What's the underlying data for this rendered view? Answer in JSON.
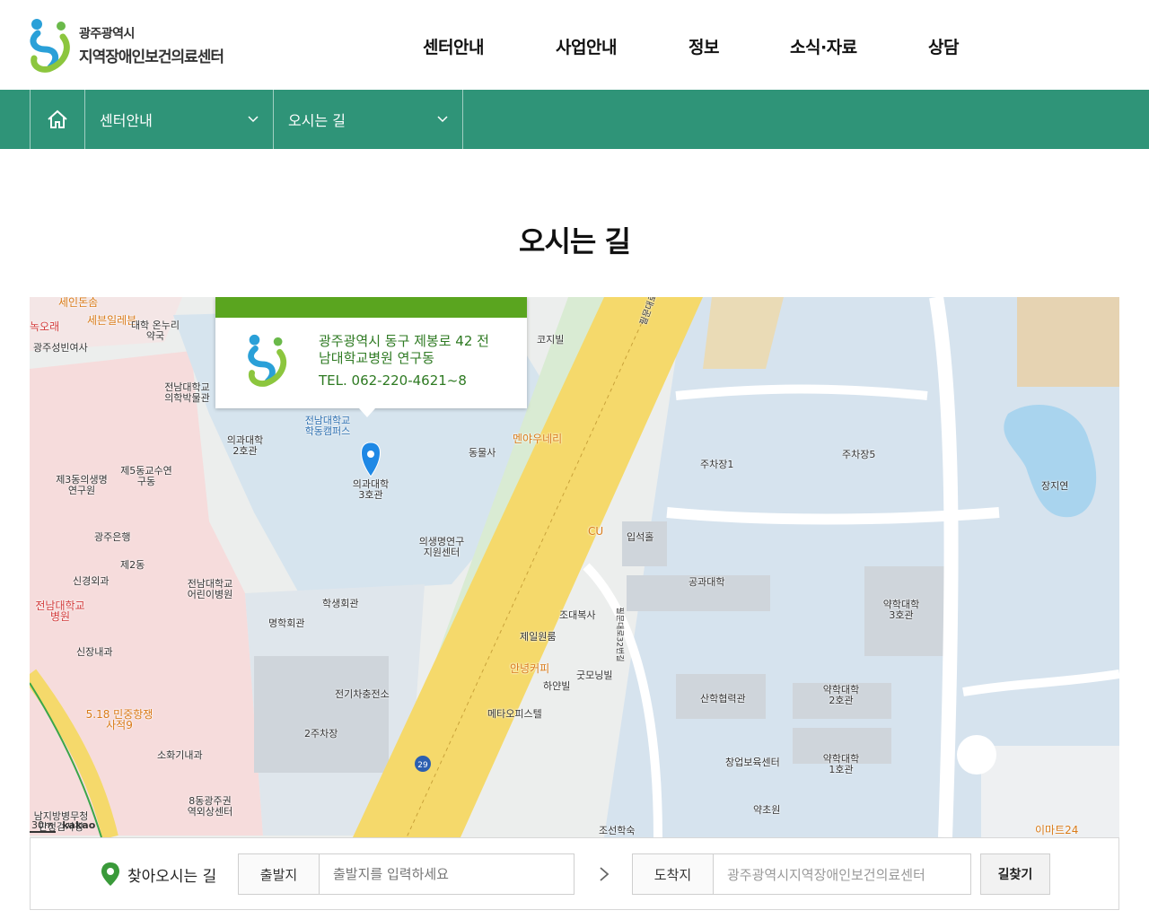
{
  "header": {
    "logo_sub": "광주광역시",
    "logo_main": "지역장애인보건의료센터",
    "nav": [
      "센터안내",
      "사업안내",
      "정보",
      "소식·자료",
      "상담"
    ]
  },
  "subnav": {
    "home_icon": "home-icon",
    "depth1": "센터안내",
    "depth2": "오시는 길"
  },
  "page": {
    "title": "오시는 길"
  },
  "map": {
    "info": {
      "address": "광주광역시 동구 제봉로 42 전남대학교병원 연구동",
      "tel": "TEL. 062-220-4621~8"
    },
    "marker_label": "의과대학\n3호관",
    "labels": [
      "세인돈솜",
      "녹오래",
      "세븐일레븐",
      "대학 온누리약국",
      "광주성빈여사",
      "코지빌",
      "전남대학교 의학박물관",
      "전남대학교 학동캠퍼스",
      "의과대학 2호관",
      "동물사",
      "멘야우네리",
      "주차장1",
      "주차장5",
      "장지연",
      "제3동의생명 연구원",
      "제5동교수연 구동",
      "광주은행",
      "제2동",
      "입석홀",
      "CU",
      "의생명연구 지원센터",
      "신경외과",
      "전남대학교 어린이병원",
      "전남대학교 병원",
      "학생회관",
      "명학회관",
      "공과대학",
      "약학대학 3호관",
      "조대복사",
      "신장내과",
      "제일원룸",
      "안녕커피",
      "굿모닝빌",
      "하얀빌",
      "전기차충전소",
      "5.18 민중항쟁 사적9",
      "2주차장",
      "메타오피스텔",
      "산학협력관",
      "약학대학 2호관",
      "소화기내과",
      "창업보육센터",
      "약학대학 1호관",
      "8동광주권 역외상센터",
      "남지방병무청 판정검사장",
      "약초원",
      "조선학숙",
      "이마트24",
      "필문대로",
      "필문대로32번길"
    ],
    "road_number": "29",
    "scale": "30m",
    "provider": "kakao"
  },
  "route": {
    "title": "찾아오시는 길",
    "from_label": "출발지",
    "from_placeholder": "출발지를 입력하세요",
    "to_label": "도착지",
    "to_value": "광주광역시지역장애인보건의료센터",
    "button": "길찾기"
  },
  "colors": {
    "nav_bar": "#2f9478",
    "info_bar": "#5aa51f",
    "road": "#f5d96b"
  }
}
